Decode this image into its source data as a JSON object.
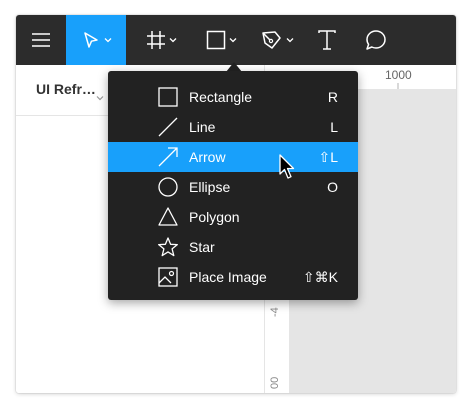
{
  "toolbar": {
    "menu_icon": "hamburger-icon",
    "tools": [
      {
        "icon": "move-arrow-icon",
        "active": true
      },
      {
        "icon": "frame-icon"
      },
      {
        "icon": "rectangle-icon"
      },
      {
        "icon": "pen-icon"
      },
      {
        "icon": "text-icon"
      },
      {
        "icon": "comment-icon"
      }
    ],
    "accent_color": "#18a0fb",
    "background_color": "#2c2c2c"
  },
  "left_panel": {
    "page_name": "UI Refr…"
  },
  "ruler": {
    "top_label": "1000",
    "left_labels": [
      "-4",
      "00"
    ]
  },
  "shape_menu": {
    "items": [
      {
        "icon": "rectangle-icon",
        "label": "Rectangle",
        "shortcut": "R"
      },
      {
        "icon": "line-icon",
        "label": "Line",
        "shortcut": "L"
      },
      {
        "icon": "arrow-icon",
        "label": "Arrow",
        "shortcut": "⇧L",
        "highlighted": true
      },
      {
        "icon": "ellipse-icon",
        "label": "Ellipse",
        "shortcut": "O"
      },
      {
        "icon": "polygon-icon",
        "label": "Polygon",
        "shortcut": ""
      },
      {
        "icon": "star-icon",
        "label": "Star",
        "shortcut": ""
      },
      {
        "icon": "image-icon",
        "label": "Place Image",
        "shortcut": "⇧⌘K"
      }
    ],
    "background_color": "#222222",
    "highlight_color": "#18a0fb"
  },
  "canvas": {
    "background_color": "#e5e5e5"
  }
}
